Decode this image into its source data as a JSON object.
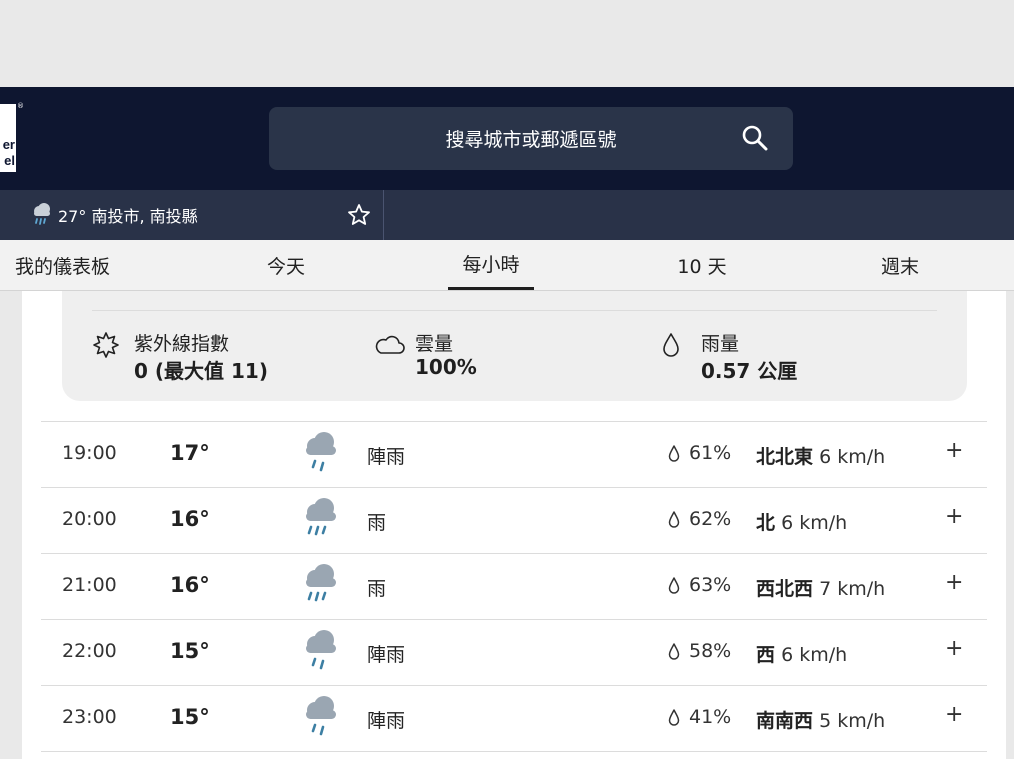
{
  "header": {
    "logo_line1": "er",
    "logo_line2": "el",
    "search_placeholder": "搜尋城市或郵遞區號"
  },
  "location_bar": {
    "temp": "27°",
    "location": "南投市, 南投縣"
  },
  "nav": {
    "tabs": [
      {
        "label": "我的儀表板"
      },
      {
        "label": "今天"
      },
      {
        "label": "每小時"
      },
      {
        "label": "10 天"
      },
      {
        "label": "週末"
      }
    ],
    "active": "每小時"
  },
  "summary": {
    "uv": {
      "label": "紫外線指數",
      "value": "0 (最大值 11)"
    },
    "cloud": {
      "label": "雲量",
      "value": "100%"
    },
    "rain": {
      "label": "雨量",
      "value": "0.57 公厘"
    }
  },
  "hourly": [
    {
      "time": "19:00",
      "temp": "17°",
      "condition": "陣雨",
      "precip": "61%",
      "wind_dir": "北北東",
      "wind_speed": "6 km/h",
      "icon": "shower-icon"
    },
    {
      "time": "20:00",
      "temp": "16°",
      "condition": "雨",
      "precip": "62%",
      "wind_dir": "北",
      "wind_speed": "6 km/h",
      "icon": "rain-icon"
    },
    {
      "time": "21:00",
      "temp": "16°",
      "condition": "雨",
      "precip": "63%",
      "wind_dir": "西北西",
      "wind_speed": "7 km/h",
      "icon": "rain-icon"
    },
    {
      "time": "22:00",
      "temp": "15°",
      "condition": "陣雨",
      "precip": "58%",
      "wind_dir": "西",
      "wind_speed": "6 km/h",
      "icon": "shower-icon"
    },
    {
      "time": "23:00",
      "temp": "15°",
      "condition": "陣雨",
      "precip": "41%",
      "wind_dir": "南南西",
      "wind_speed": "5 km/h",
      "icon": "shower-icon"
    }
  ],
  "expand_symbol": "+",
  "colors": {
    "header_bg": "#0e1630",
    "search_bg": "#2a3449",
    "location_bar_bg": "#293248",
    "cloud": "#9aa6b2",
    "rain_drops": "#3d7fa3"
  }
}
